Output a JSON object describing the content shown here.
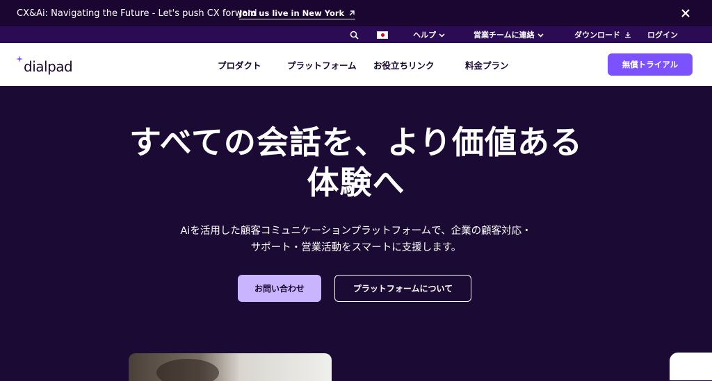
{
  "banner": {
    "text": "CX&Ai: Navigating the Future - Let's push CX forward",
    "link_label": "Join us live in New York",
    "close_icon": "close-icon"
  },
  "utility": {
    "search_icon": "search-icon",
    "flag_icon": "japan-flag-icon",
    "help_label": "ヘルプ",
    "sales_label": "営業チームに連絡",
    "download_label": "ダウンロード",
    "login_label": "ログイン"
  },
  "nav": {
    "logo_text": "dialpad",
    "items": [
      "プロダクト",
      "プラットフォーム",
      "お役立ちリンク",
      "料金プラン"
    ],
    "trial_label": "無償トライアル"
  },
  "hero": {
    "title_line1": "すべての会話を、より価値ある",
    "title_line2": "体験へ",
    "subtitle_line1": "Aiを活用した顧客コミュニケーションプラットフォームで、企業の顧客対応・",
    "subtitle_line2": "サポート・営業活動をスマートに支援します。",
    "contact_label": "お問い合わせ",
    "platform_label": "プラットフォームについて"
  },
  "colors": {
    "banner_bg": "#1a0630",
    "utility_bg": "#2a0b54",
    "hero_bg": "#1b0a33",
    "accent": "#7c52ff",
    "contact_btn": "#c9b4ff"
  }
}
